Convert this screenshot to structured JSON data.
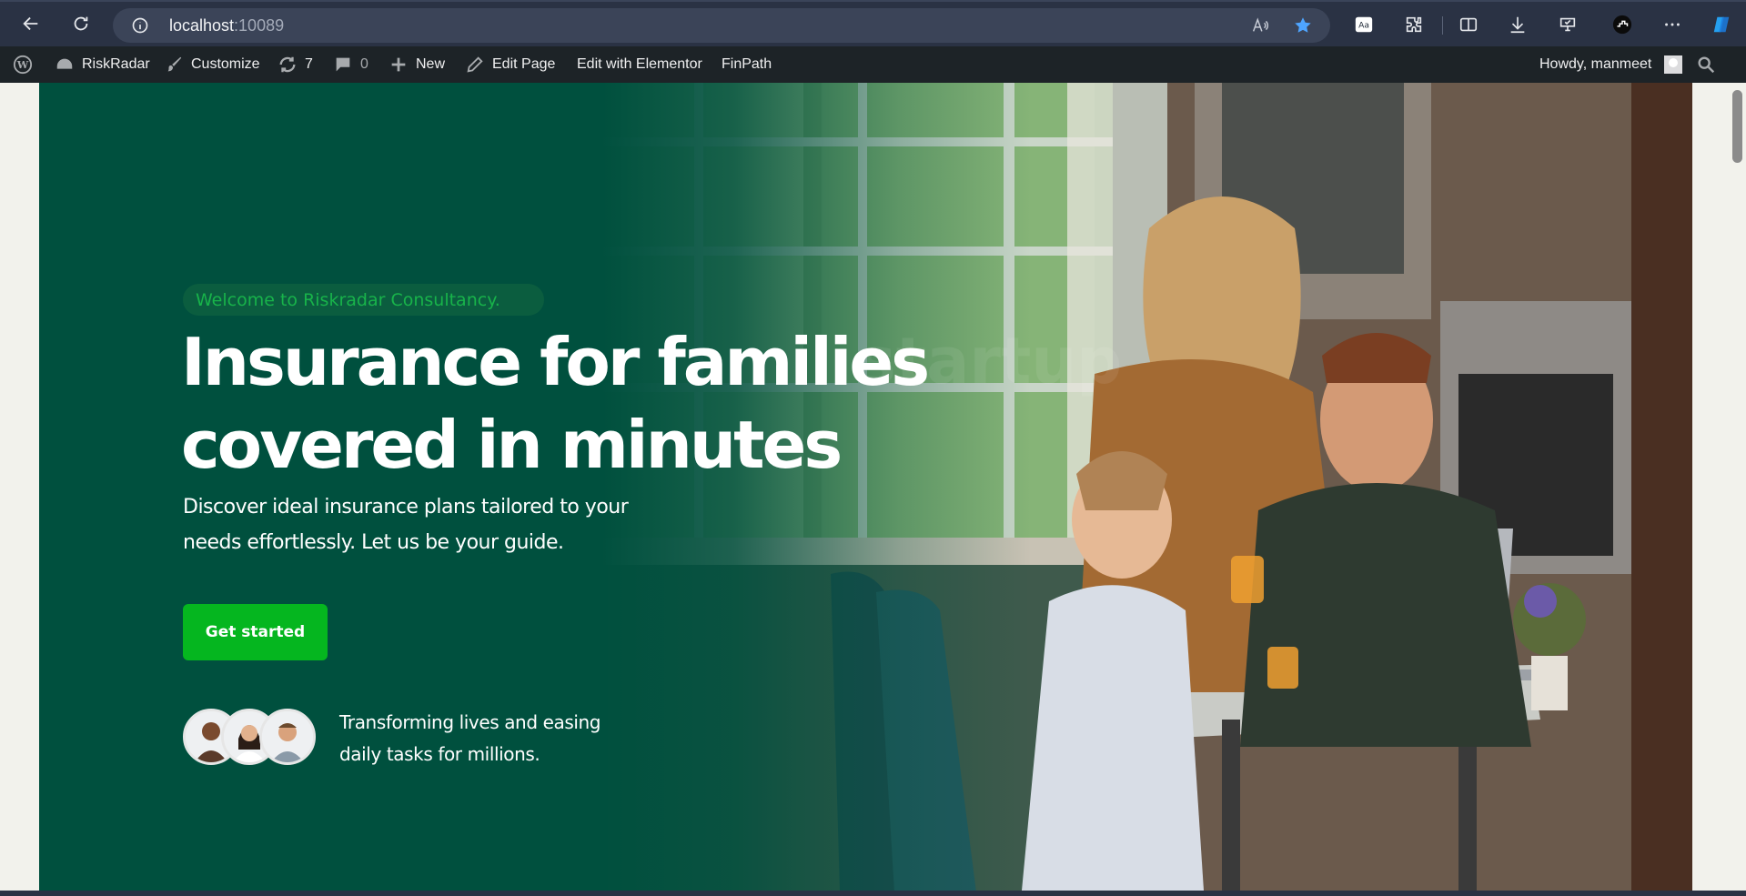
{
  "browser": {
    "url_host": "localhost",
    "url_port": ":10089",
    "icons": [
      "back-icon",
      "refresh-icon",
      "info-icon",
      "read-aloud-icon",
      "favorite-star-icon",
      "immersive-reader-icon",
      "extensions-icon",
      "split-screen-icon",
      "downloads-icon",
      "browser-essentials-icon",
      "profile-icon",
      "more-icon",
      "copilot-icon"
    ]
  },
  "admin_bar": {
    "site_name": "RiskRadar",
    "customize": "Customize",
    "updates_count": "7",
    "comments_count": "0",
    "new": "New",
    "edit_page": "Edit Page",
    "edit_elementor": "Edit with Elementor",
    "finpath": "FinPath",
    "howdy": "Howdy, manmeet"
  },
  "hero": {
    "welcome": "Welcome to Riskradar Consultancy.",
    "title_line1": "Insurance for families",
    "title_line2": "covered in minutes",
    "subtitle_line1": "Discover ideal insurance plans tailored to your",
    "subtitle_line2": "needs effortlessly. Let us be your guide.",
    "cta": "Get started",
    "trust_line1": "Transforming lives and easing",
    "trust_line2": "daily tasks for millions.",
    "ghost_text": "startup"
  },
  "colors": {
    "hero_green": "#00503e",
    "accent_green": "#05b61f",
    "welcome_text": "#18b34a",
    "admin_bar": "#1d2327"
  }
}
